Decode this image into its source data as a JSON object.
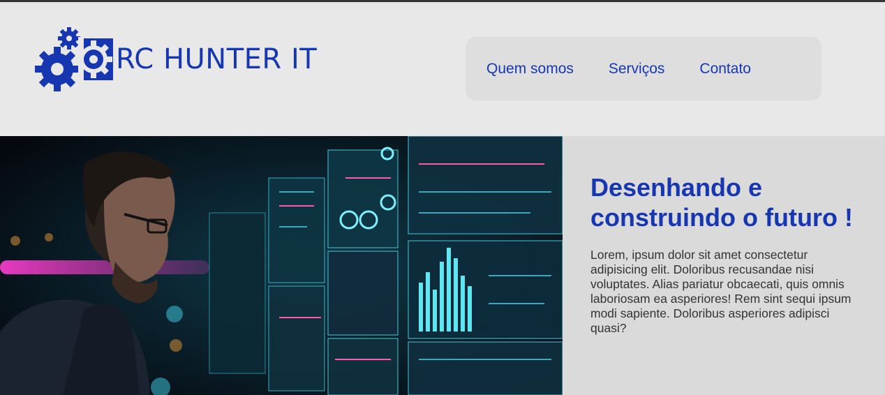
{
  "header": {
    "brand_name": "RC HUNTER IT",
    "logo_icon": "gears-icon"
  },
  "nav": {
    "items": [
      {
        "label": "Quem somos"
      },
      {
        "label": "Serviços"
      },
      {
        "label": "Contato"
      }
    ]
  },
  "hero": {
    "image": "hero-photo-man-monitors",
    "title": "Desenhando e construindo o futuro !",
    "body": "Lorem, ipsum dolor sit amet consectetur adipisicing elit. Doloribus recusandae nisi voluptates. Alias pariatur obcaecati, quis omnis laboriosam ea asperiores! Rem sint sequi ipsum modi sapiente. Doloribus asperiores adipisci quasi?"
  },
  "colors": {
    "brand": "#1737b0",
    "header_bg": "#e8e8e8",
    "nav_bg": "#dedede",
    "hero_text_bg": "#dadada",
    "body_text": "#333333"
  }
}
